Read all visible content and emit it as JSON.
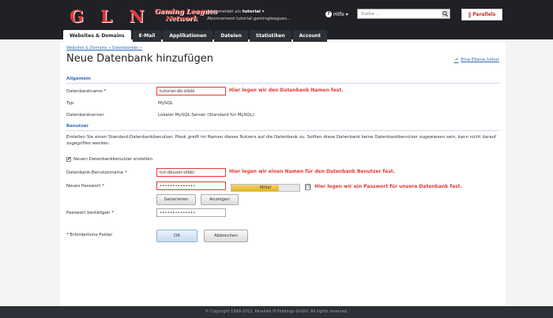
{
  "header": {
    "logo_letters": "G L N",
    "brand_line1": "Gaming Leagues",
    "brand_line2": "Network",
    "logged_in_label": "Angemeldet als",
    "logged_in_user": "tutorial",
    "subscription_label": "Abonnement",
    "subscription_value": "tutorial.gamingleagues...",
    "help_label": "Hilfe",
    "search_placeholder": "Suche ...",
    "partner_logo": "Parallels"
  },
  "tabs": [
    {
      "label": "Websites & Domains",
      "active": true
    },
    {
      "label": "E-Mail",
      "active": false
    },
    {
      "label": "Applikationen",
      "active": false
    },
    {
      "label": "Dateien",
      "active": false
    },
    {
      "label": "Statistiken",
      "active": false
    },
    {
      "label": "Account",
      "active": false
    }
  ],
  "main": {
    "breadcrumb": "Websites & Domains » Datenbanken »",
    "title": "Neue Datenbank hinzufügen",
    "help_link": "Eine Ebene höher",
    "general": {
      "heading": "Allgemein",
      "db_name_label": "Datenbankname *",
      "db_name_value": "tutorial-db-stbbl",
      "db_name_annotation": "Hier legen wir den Datenbank Namen fest.",
      "type_label": "Typ",
      "type_value": "MySQL",
      "server_label": "Datenbankserver",
      "server_value": "Lokaler MySQL-Server (Standard für MySQL)"
    },
    "users": {
      "heading": "Benutzer",
      "description": "Erstellen Sie einen Standard-Datenbankbenutzer. Plesk greift im Namen dieses Nutzers auf die Datenbank zu. Sollten diese Datenbank keine Datenbankbenutzer zugewiesen sein, kann nicht darauf zugegriffen werden.",
      "create_user_label": "Neuen Datenbankbenutzer erstellen",
      "username_label": "Datenbank-Benutzername *",
      "username_value": "tut-dbuser-stbbl",
      "username_annotation": "Hier legen wir einen Namen für den Datenbank Benutzer fest.",
      "password_label": "Neues Passwort *",
      "password_value": "••••••••••••••",
      "password_annotation": "Hier legen wir ein Passwort für unsere Datenbank fest.",
      "strength_label": "Mittel",
      "strength_fraction": 0.7,
      "strength_help": "[?]",
      "generate_button": "Generieren",
      "show_button": "Anzeigen",
      "confirm_label": "Passwort bestätigen *",
      "confirm_value": "••••••••••••••"
    },
    "required_note": "* Erforderliche Felder",
    "ok_button": "OK",
    "cancel_button": "Abbrechen"
  },
  "footer": {
    "text": "© Copyright 1999-2012, Parallels IP Holdings GmbH. All rights reserved."
  }
}
